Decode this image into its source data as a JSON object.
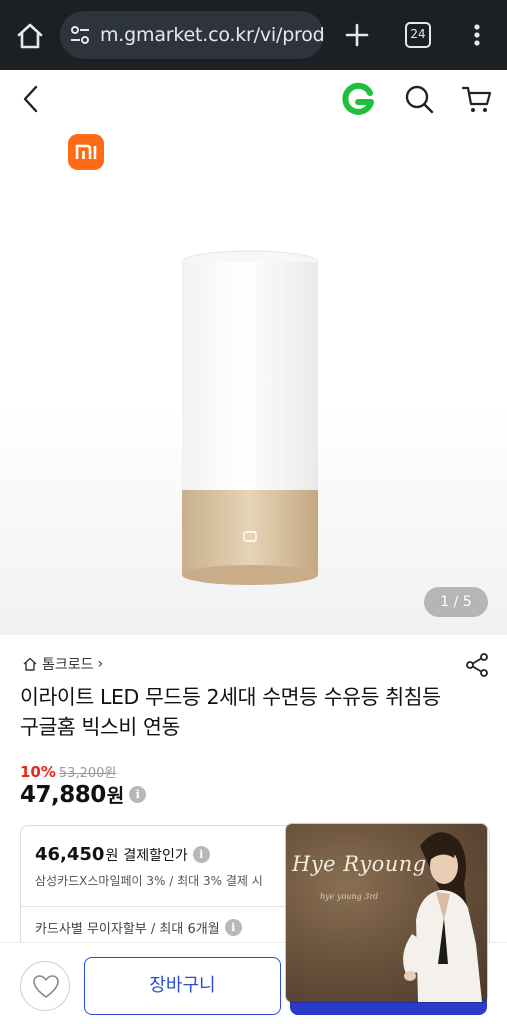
{
  "browser": {
    "url": "m.gmarket.co.kr/vi/prod",
    "tab_count": "24"
  },
  "gallery": {
    "page_indicator": "1 / 5"
  },
  "shop": {
    "name": "톰크로드",
    "chevron": "›"
  },
  "product": {
    "title": "이라이트 LED 무드등 2세대 수면등 수유등 취침등 구글홈 빅스비 연동",
    "discount_rate": "10%",
    "original_price": "53,200원",
    "price": "47,880",
    "price_unit": "원"
  },
  "coupon": {
    "price": "46,450",
    "unit": "원",
    "label": "결제할인가",
    "sub": "삼성카드X스마일페이 3% / 최대 3% 결제 시",
    "installment": "카드사별 무이자할부 / 최대 6개월"
  },
  "actions": {
    "cart_label": "장바구니"
  },
  "video": {
    "title": "Hye Ryoung",
    "subtitle": "hye young 3rd"
  },
  "icons": {
    "info": "i"
  },
  "colors": {
    "accent": "#2a3bc9",
    "discount": "#e8271b",
    "gmarket_green": "#1fbf3b",
    "xiaomi_orange": "#ff6a14"
  }
}
